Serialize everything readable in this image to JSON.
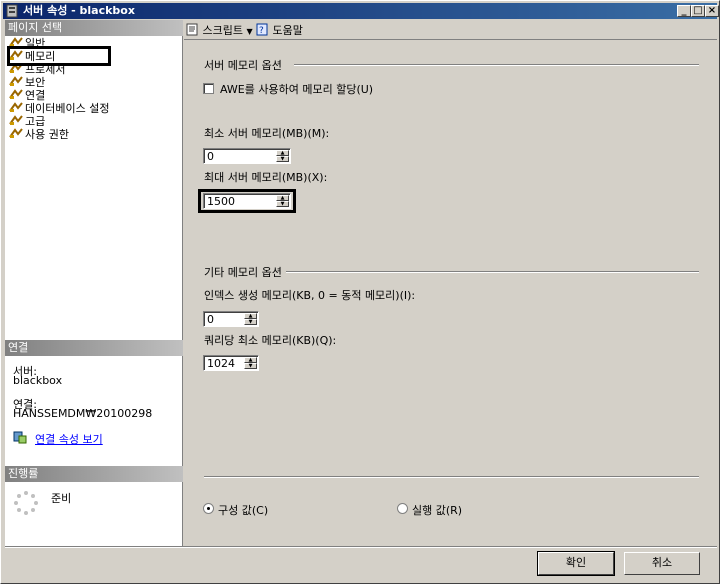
{
  "window": {
    "title": "서버 속성 - blackbox",
    "min": "_",
    "max": "□",
    "close": "×"
  },
  "left": {
    "page_select_header": "페이지 선택",
    "nav_items": [
      "일반",
      "메모리",
      "프로세서",
      "보안",
      "연결",
      "데이터베이스 설정",
      "고급",
      "사용 권한"
    ],
    "connection_header": "연결",
    "server_label": "서버:",
    "server_value": "blackbox",
    "conn_label": "연결:",
    "conn_value": "HANSSEMDM₩20100298",
    "view_conn_props": "연결 속성 보기",
    "progress_header": "진행률",
    "progress_status": "준비"
  },
  "toolbar": {
    "script_label": "스크립트",
    "help_label": "도움말"
  },
  "server_memory": {
    "title": "서버 메모리 옵션",
    "awe_label": "AWE를 사용하여 메모리 할당(U)",
    "min_label": "최소 서버 메모리(MB)(M):",
    "min_value": "0",
    "max_label": "최대 서버 메모리(MB)(X):",
    "max_value": "1500"
  },
  "other_memory": {
    "title": "기타 메모리 옵션",
    "index_label": "인덱스 생성 메모리(KB, 0 = 동적 메모리)(I):",
    "index_value": "0",
    "query_label": "쿼리당 최소 메모리(KB)(Q):",
    "query_value": "1024"
  },
  "radios": {
    "configured": "구성 값(C)",
    "running": "실행 값(R)"
  },
  "buttons": {
    "ok": "확인",
    "cancel": "취소"
  }
}
